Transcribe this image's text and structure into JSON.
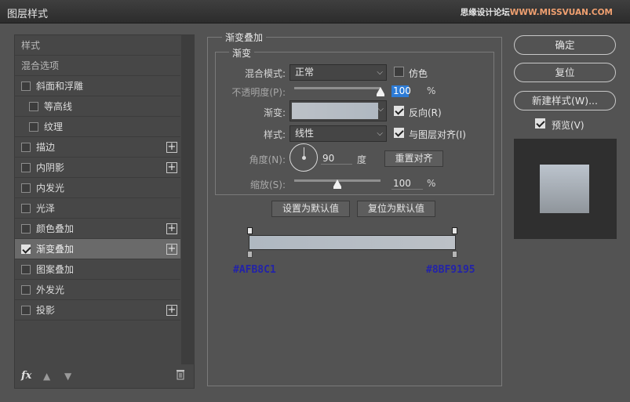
{
  "window": {
    "title": "图层样式",
    "watermark_a": "思缘设计论坛",
    "watermark_b": "WWW.MISSVUAN.COM"
  },
  "left_panel": {
    "headers": [
      {
        "label": "样式"
      },
      {
        "label": "混合选项"
      }
    ],
    "items": [
      {
        "label": "斜面和浮雕",
        "checked": false,
        "plus": false,
        "indent": 0
      },
      {
        "label": "等高线",
        "checked": false,
        "plus": false,
        "indent": 1
      },
      {
        "label": "纹理",
        "checked": false,
        "plus": false,
        "indent": 1
      },
      {
        "label": "描边",
        "checked": false,
        "plus": true,
        "indent": 0
      },
      {
        "label": "内阴影",
        "checked": false,
        "plus": true,
        "indent": 0
      },
      {
        "label": "内发光",
        "checked": false,
        "plus": false,
        "indent": 0
      },
      {
        "label": "光泽",
        "checked": false,
        "plus": false,
        "indent": 0
      },
      {
        "label": "颜色叠加",
        "checked": false,
        "plus": true,
        "indent": 0
      },
      {
        "label": "渐变叠加",
        "checked": true,
        "plus": true,
        "indent": 0,
        "selected": true
      },
      {
        "label": "图案叠加",
        "checked": false,
        "plus": false,
        "indent": 0
      },
      {
        "label": "外发光",
        "checked": false,
        "plus": false,
        "indent": 0
      },
      {
        "label": "投影",
        "checked": false,
        "plus": true,
        "indent": 0
      }
    ],
    "footer": {
      "fx_label": "fx",
      "up_icon": "arrow-up-icon",
      "down_icon": "arrow-down-icon",
      "trash_icon": "trash-icon"
    }
  },
  "gradient_overlay": {
    "group_title": "渐变叠加",
    "sub_title": "渐变",
    "blend_mode": {
      "label": "混合模式:",
      "value": "正常"
    },
    "dither": {
      "label": "仿色",
      "checked": false
    },
    "opacity": {
      "label": "不透明度(P):",
      "value": "100",
      "unit": "%",
      "level": 1.0
    },
    "gradient": {
      "label": "渐变:"
    },
    "reverse": {
      "label": "反向(R)",
      "checked": true
    },
    "style": {
      "label": "样式:",
      "value": "线性"
    },
    "align": {
      "label": "与图层对齐(I)",
      "checked": true
    },
    "angle": {
      "label": "角度(N):",
      "value": "90",
      "unit": "度",
      "degrees": 90
    },
    "reset_align_button": "重置对齐",
    "scale": {
      "label": "缩放(S):",
      "value": "100",
      "unit": "%",
      "level": 0.5
    },
    "set_default_button": "设置为默认值",
    "reset_default_button": "复位为默认值"
  },
  "gradient_editor": {
    "left_color": "#AFB8C1",
    "right_color": "#8BF9195",
    "left_hex_label": "#AFB8C1",
    "right_hex_label": "#8BF9195",
    "bar_start": "#afb8c1",
    "bar_end": "#bcc1c7"
  },
  "right_panel": {
    "ok_button": "确定",
    "reset_button": "复位",
    "new_style_button": "新建样式(W)...",
    "preview": {
      "label": "预览(V)",
      "checked": true
    },
    "preview_top": "#bcc4cd",
    "preview_bottom": "#8f959b"
  }
}
